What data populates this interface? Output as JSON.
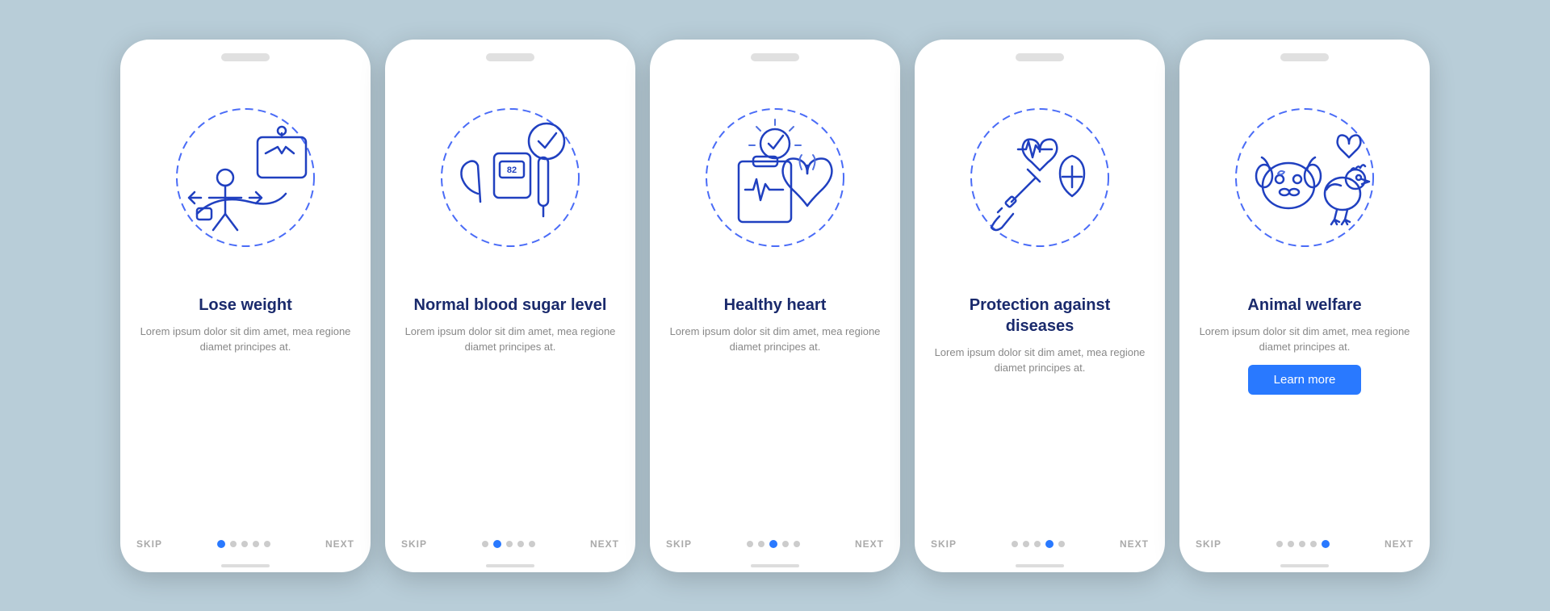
{
  "bg_color": "#b8cdd8",
  "phones": [
    {
      "id": "lose-weight",
      "title": "Lose weight",
      "description": "Lorem ipsum dolor sit dim amet, mea regione diamet principes at.",
      "skip_label": "SKIP",
      "next_label": "NEXT",
      "dots": [
        1,
        0,
        0,
        0,
        0
      ],
      "active_dot": 0,
      "show_learn_more": false
    },
    {
      "id": "blood-sugar",
      "title": "Normal blood sugar level",
      "description": "Lorem ipsum dolor sit dim amet, mea regione diamet principes at.",
      "skip_label": "SKIP",
      "next_label": "NEXT",
      "dots": [
        0,
        1,
        0,
        0,
        0
      ],
      "active_dot": 1,
      "show_learn_more": false
    },
    {
      "id": "healthy-heart",
      "title": "Healthy heart",
      "description": "Lorem ipsum dolor sit dim amet, mea regione diamet principes at.",
      "skip_label": "SKIP",
      "next_label": "NEXT",
      "dots": [
        0,
        0,
        1,
        0,
        0
      ],
      "active_dot": 2,
      "show_learn_more": false
    },
    {
      "id": "protection",
      "title": "Protection against diseases",
      "description": "Lorem ipsum dolor sit dim amet, mea regione diamet principes at.",
      "skip_label": "SKIP",
      "next_label": "NEXT",
      "dots": [
        0,
        0,
        0,
        1,
        0
      ],
      "active_dot": 3,
      "show_learn_more": false
    },
    {
      "id": "animal-welfare",
      "title": "Animal welfare",
      "description": "Lorem ipsum dolor sit dim amet, mea regione diamet principes at.",
      "skip_label": "SKIP",
      "next_label": "NEXT",
      "dots": [
        0,
        0,
        0,
        0,
        1
      ],
      "active_dot": 4,
      "show_learn_more": true,
      "learn_more_label": "Learn more"
    }
  ]
}
